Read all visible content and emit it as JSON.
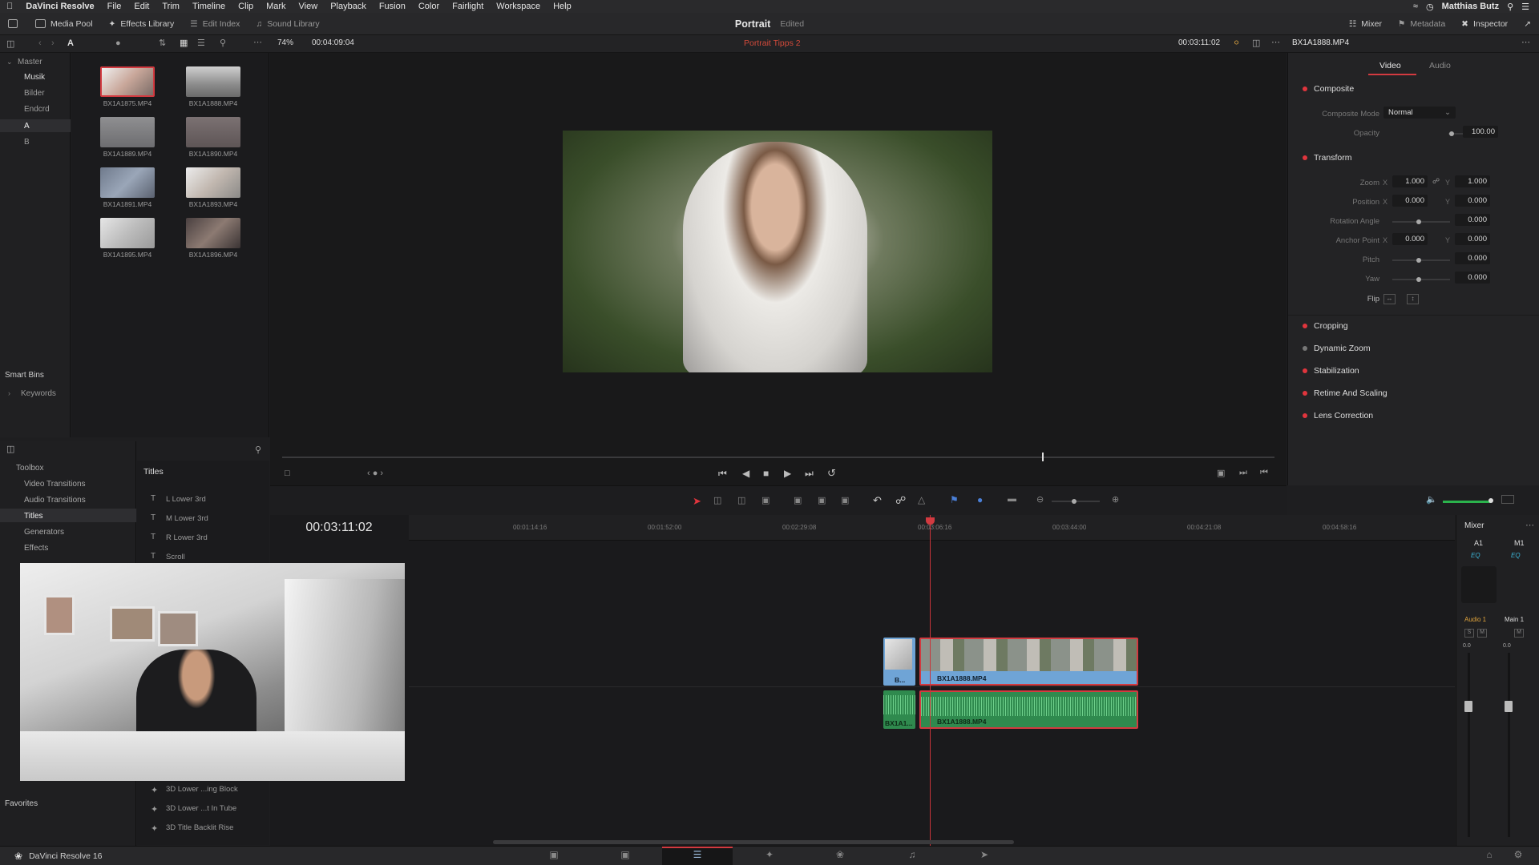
{
  "menubar": {
    "app": "DaVinci Resolve",
    "items": [
      "File",
      "Edit",
      "Trim",
      "Timeline",
      "Clip",
      "Mark",
      "View",
      "Playback",
      "Fusion",
      "Color",
      "Fairlight",
      "Workspace",
      "Help"
    ],
    "user": "Matthias Butz"
  },
  "toolbar": {
    "media_pool": "Media Pool",
    "effects_library": "Effects Library",
    "edit_index": "Edit Index",
    "sound_library": "Sound Library",
    "project_title": "Portrait",
    "project_status": "Edited",
    "mixer": "Mixer",
    "metadata": "Metadata",
    "inspector": "Inspector"
  },
  "subbar": {
    "bin_letter": "A",
    "zoom": "74%",
    "duration": "00:04:09:04",
    "timeline_name": "Portrait Tipps 2",
    "timecode": "00:03:11:02",
    "clip_name": "BX1A1888.MP4"
  },
  "bins": {
    "master": "Master",
    "items": [
      "Musik",
      "Bilder",
      "Endcrd",
      "A",
      "B"
    ],
    "smart_bins": "Smart Bins",
    "keywords": "Keywords"
  },
  "clips": [
    {
      "name": "BX1A1875.MP4"
    },
    {
      "name": "BX1A1888.MP4"
    },
    {
      "name": "BX1A1889.MP4"
    },
    {
      "name": "BX1A1890.MP4"
    },
    {
      "name": "BX1A1891.MP4"
    },
    {
      "name": "BX1A1893.MP4"
    },
    {
      "name": "BX1A1895.MP4"
    },
    {
      "name": "BX1A1896.MP4"
    }
  ],
  "inspector": {
    "tabs": [
      "Video",
      "Audio"
    ],
    "sections": {
      "composite": "Composite",
      "composite_mode_label": "Composite Mode",
      "composite_mode_value": "Normal",
      "opacity_label": "Opacity",
      "opacity_value": "100.00",
      "transform": "Transform",
      "zoom_label": "Zoom",
      "zoom_x": "1.000",
      "zoom_y": "1.000",
      "position_label": "Position",
      "position_x": "0.000",
      "position_y": "0.000",
      "rotation_label": "Rotation Angle",
      "rotation_value": "0.000",
      "anchor_label": "Anchor Point",
      "anchor_x": "0.000",
      "anchor_y": "0.000",
      "pitch_label": "Pitch",
      "pitch_value": "0.000",
      "yaw_label": "Yaw",
      "yaw_value": "0.000",
      "flip_label": "Flip",
      "cropping": "Cropping",
      "dynamic_zoom": "Dynamic Zoom",
      "stabilization": "Stabilization",
      "retime": "Retime And Scaling",
      "lens": "Lens Correction"
    },
    "axis_x": "X",
    "axis_y": "Y"
  },
  "toolbox": {
    "root": "Toolbox",
    "items": [
      "Video Transitions",
      "Audio Transitions",
      "Titles",
      "Generators",
      "Effects"
    ],
    "favorites": "Favorites"
  },
  "titles": {
    "header": "Titles",
    "items": [
      "L Lower 3rd",
      "M Lower 3rd",
      "R Lower 3rd",
      "Scroll"
    ],
    "fusion_items": [
      "3D Lower ...ing Block",
      "3D Lower ...t In Tube",
      "3D Title Backlit Rise"
    ]
  },
  "timeline": {
    "timecode": "00:03:11:02",
    "ruler": [
      "00:01:14:16",
      "00:01:52:00",
      "00:02:29:08",
      "00:03:06:16",
      "00:03:44:00",
      "00:04:21:08",
      "00:04:58:16"
    ],
    "video_clip_short": "B...",
    "video_clip": "BX1A1888.MP4",
    "audio_clip_short": "BX1A1...",
    "audio_clip": "BX1A1888.MP4"
  },
  "mixer": {
    "title": "Mixer",
    "a1": "A1",
    "m1": "M1",
    "eq": "EQ",
    "audio1": "Audio 1",
    "main1": "Main 1",
    "s": "S",
    "m": "M",
    "level_a": "0.0",
    "level_b": "0.0"
  },
  "bottom": {
    "app_name": "DaVinci Resolve 16"
  },
  "colors": {
    "accent_red": "#e0353d",
    "video_clip": "#6fa4d6",
    "audio_clip": "#2f8a4e",
    "timeline_name": "#d24a3a"
  }
}
